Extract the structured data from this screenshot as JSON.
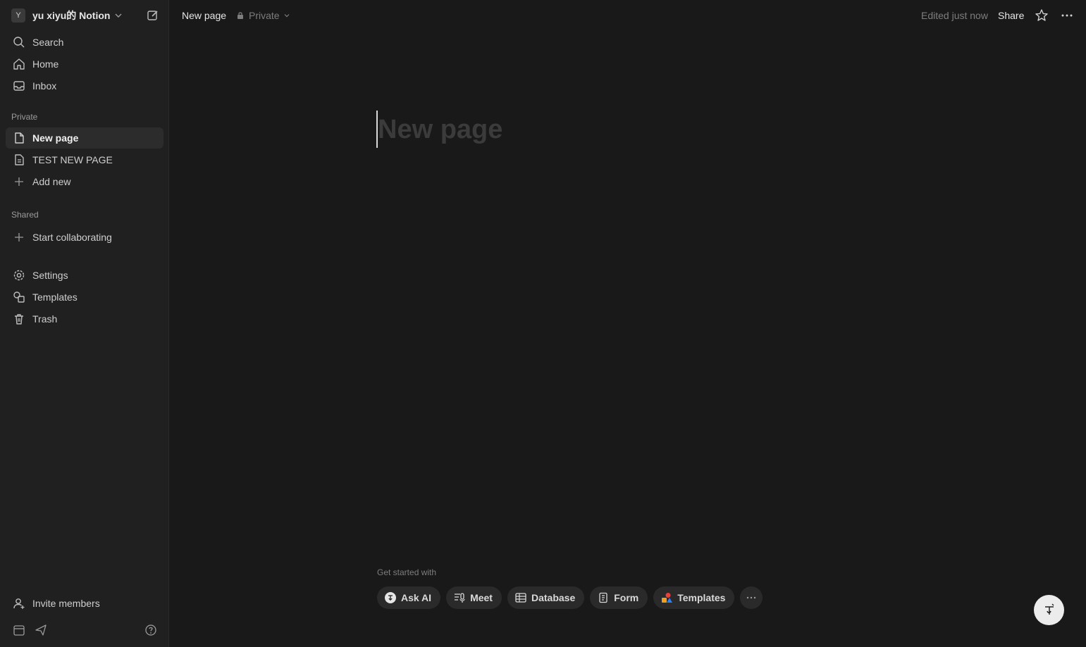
{
  "workspace": {
    "avatar_letter": "Y",
    "name": "yu xiyu的 Notion"
  },
  "nav": {
    "search": "Search",
    "home": "Home",
    "inbox": "Inbox"
  },
  "private": {
    "label": "Private",
    "pages": [
      {
        "label": "New page",
        "active": true
      },
      {
        "label": "TEST NEW PAGE",
        "active": false
      }
    ],
    "add_new": "Add new"
  },
  "shared": {
    "label": "Shared",
    "start": "Start collaborating"
  },
  "utility": {
    "settings": "Settings",
    "templates": "Templates",
    "trash": "Trash"
  },
  "footer": {
    "invite": "Invite members"
  },
  "topbar": {
    "title": "New page",
    "visibility": "Private",
    "edited": "Edited just now",
    "share": "Share"
  },
  "editor": {
    "title_placeholder": "New page"
  },
  "get_started": {
    "label": "Get started with",
    "chips": [
      "Ask AI",
      "Meet",
      "Database",
      "Form",
      "Templates"
    ]
  },
  "colors": {
    "background": "#191919",
    "sidebar": "#202020",
    "accent_fab": "#ececec"
  }
}
